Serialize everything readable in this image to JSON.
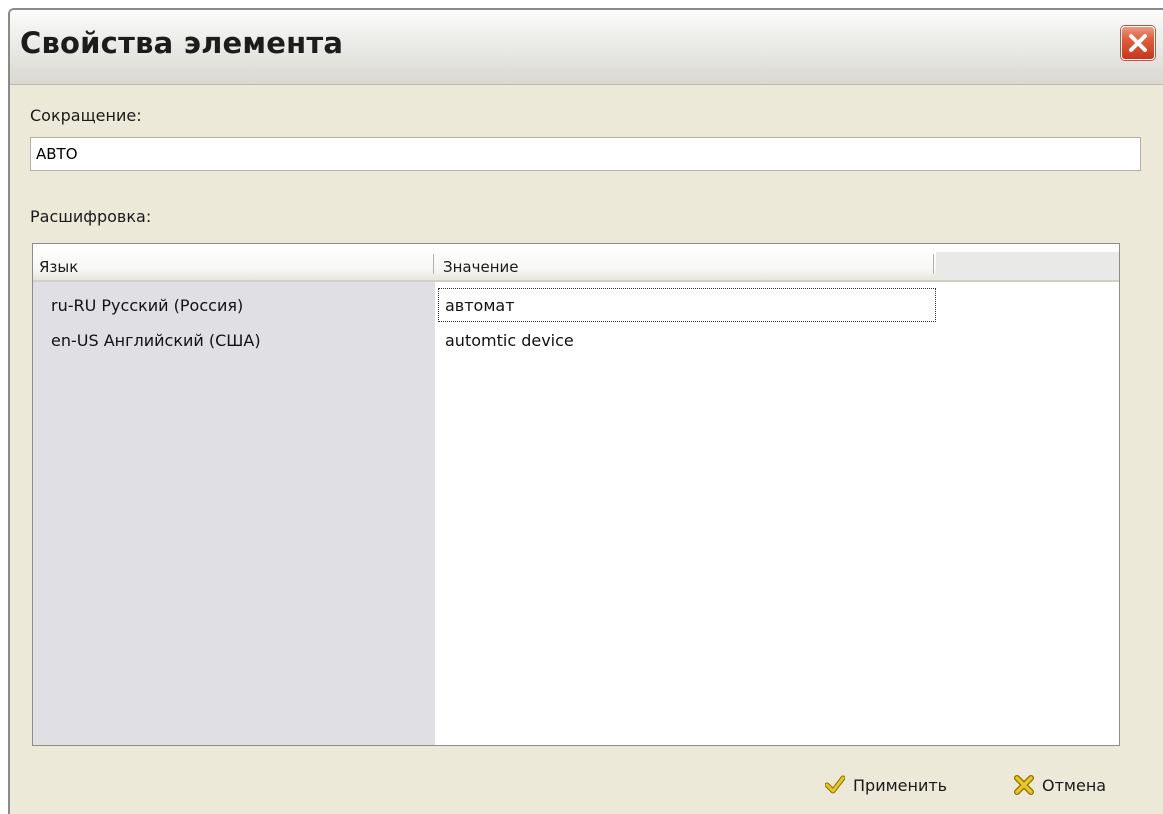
{
  "window": {
    "title": "Свойства элемента"
  },
  "abbreviation": {
    "label": "Сокращение:",
    "value": "АВТО"
  },
  "decoding": {
    "label": "Расшифровка:",
    "columns": [
      "Язык",
      "Значение"
    ],
    "rows": [
      {
        "language": "ru-RU  Русский (Россия)",
        "value": "автомат"
      },
      {
        "language": "en-US  Английский (США)",
        "value": "automtic device"
      }
    ]
  },
  "buttons": {
    "apply": "Применить",
    "cancel": "Отмена"
  },
  "icons": {
    "close": "close-icon",
    "apply": "checkmark-icon",
    "cancel": "cross-icon"
  },
  "colors": {
    "window_bg": "#ece9d8",
    "close_button": "#e0603f",
    "checkmark": "#d8b400",
    "cross": "#d8b400"
  }
}
